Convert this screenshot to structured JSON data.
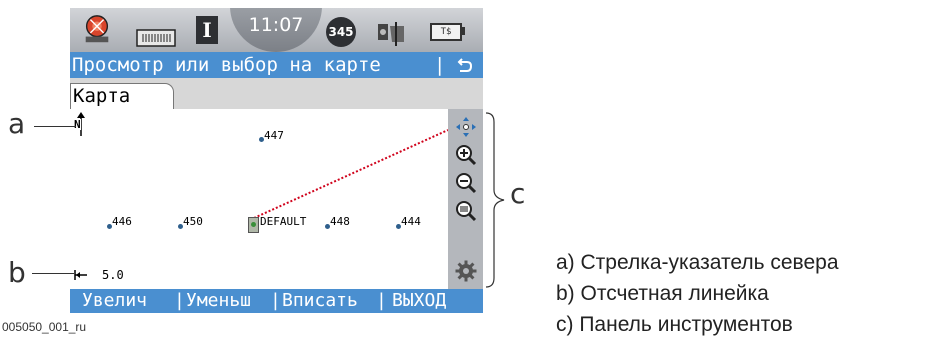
{
  "status_bar": {
    "time": "11:07",
    "satellites": "345",
    "instrument_letter": "I",
    "battery_label": "T$"
  },
  "title_bar": {
    "title": "Просмотр или выбор на карте",
    "separator": "|",
    "back_icon": "back-arrow-icon"
  },
  "tabs": [
    {
      "label": "Карта",
      "active": true
    }
  ],
  "map": {
    "north_arrow": "N",
    "scale_value": "5.0",
    "points": [
      {
        "name": "447"
      },
      {
        "name": "446"
      },
      {
        "name": "450"
      },
      {
        "name": "DEFAULT"
      },
      {
        "name": "448"
      },
      {
        "name": "444"
      }
    ]
  },
  "toolbar": {
    "tools": [
      "pan-icon",
      "zoom-in-icon",
      "zoom-out-icon",
      "zoom-fit-icon",
      "settings-gear-icon"
    ]
  },
  "softkeys": [
    "Увелич",
    "Уменьш",
    "Вписать",
    "ВЫХОД"
  ],
  "callouts": {
    "a": "a",
    "b": "b",
    "c": "c"
  },
  "legend": [
    "a)  Стрелка-указатель севера",
    "b)  Отсчетная линейка",
    "c)  Панель инструментов"
  ],
  "figure_id": "005050_001_ru",
  "colors": {
    "title_bar": "#4a8fd0",
    "toolbar": "#b4b7bc",
    "point": "#2f5f8c",
    "line": "#d0021b"
  }
}
